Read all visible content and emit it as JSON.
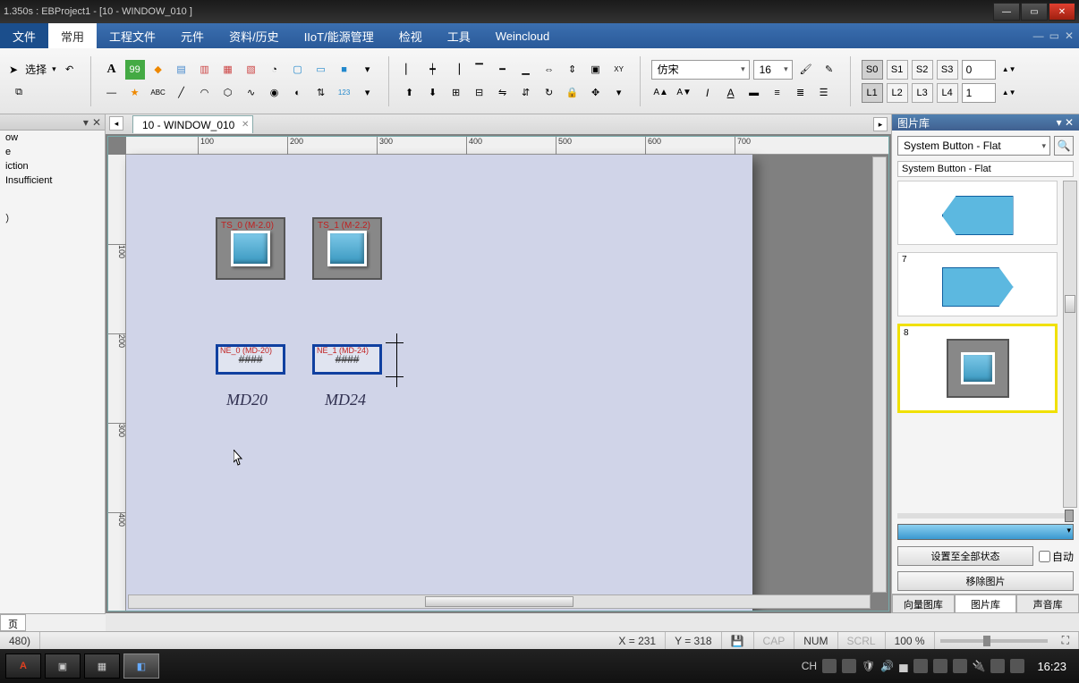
{
  "window": {
    "title": "1.350s : EBProject1 - [10 - WINDOW_010 ]"
  },
  "menu": {
    "file": "文件",
    "items": [
      "常用",
      "工程文件",
      "元件",
      "资料/历史",
      "IIoT/能源管理",
      "检视",
      "工具",
      "Weincloud"
    ],
    "active": 0
  },
  "ribbon": {
    "select_label": "选择",
    "font_name": "仿宋",
    "font_size": "16",
    "states": [
      "S0",
      "S1",
      "S2",
      "S3"
    ],
    "state_value": "0",
    "langs": [
      "L1",
      "L2",
      "L3",
      "L4"
    ],
    "lang_value": "1"
  },
  "left_tree": {
    "items": [
      "ow",
      "e",
      "iction",
      "Insufficient",
      "",
      "）"
    ]
  },
  "left_bottom_tab": "页",
  "coord_left": "480)",
  "doctab": {
    "label": "10 - WINDOW_010"
  },
  "ruler_h": [
    "100",
    "200",
    "300",
    "400",
    "500",
    "600",
    "700"
  ],
  "ruler_v": [
    "100",
    "200",
    "300",
    "400"
  ],
  "canvas_objects": {
    "btn1_label": "TS_0 (M-2.0)",
    "btn2_label": "TS_1 (M-2.2)",
    "num1_label": "NE_0 (MD-20)",
    "num1_text": "####",
    "num2_label": "NE_1 (MD-24)",
    "num2_text": "####",
    "txt1": "MD20",
    "txt2": "MD24"
  },
  "rightpanel": {
    "title": "图片库",
    "combo": "System Button - Flat",
    "label": "System Button - Flat",
    "item7": "7",
    "item8": "8",
    "btn_setall": "设置至全部状态",
    "chk_auto": "自动",
    "btn_remove": "移除图片",
    "tabs": [
      "向量图库",
      "图片库",
      "声音库"
    ],
    "active_tab": 1,
    "search_icon": "🔍"
  },
  "status": {
    "x": "X = 231",
    "y": "Y = 318",
    "cap": "CAP",
    "num": "NUM",
    "scrl": "SCRL",
    "zoom": "100 %",
    "save_icon": "💾"
  },
  "taskbar": {
    "lang": "CH",
    "clock": "16:23"
  }
}
